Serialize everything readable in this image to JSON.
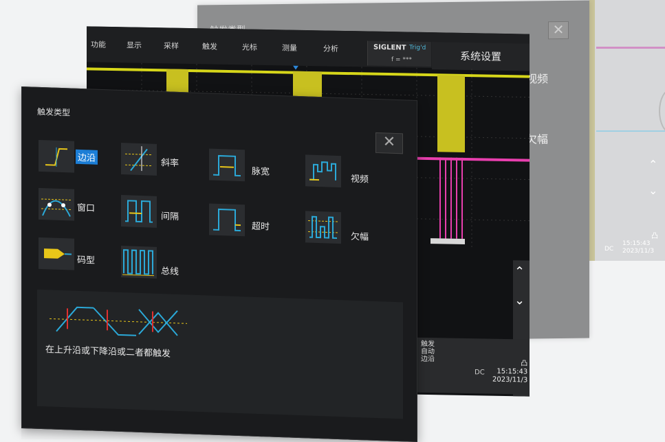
{
  "back_panel": {
    "title": "触发类型",
    "close": "✕",
    "video_label": "视频",
    "runt_label": "欠幅",
    "channel": "凸",
    "dc": "DC",
    "time": "15:15:43",
    "date": "2023/11/3",
    "up_arrow": "⌃",
    "down_arrow": "⌄"
  },
  "mid_panel": {
    "menu": [
      "功能",
      "显示",
      "采样",
      "触发",
      "光标",
      "测量",
      "分析"
    ],
    "brand": "SIGLENT",
    "brand_sub": "Trig'd",
    "brand_line2": "f = ***",
    "system_button": "系统设置",
    "status_lines": [
      "触发",
      "自动",
      "边沿"
    ],
    "dc": "DC",
    "time": "15:15:43",
    "date": "2023/11/3",
    "channel": "凸",
    "up_arrow": "⌃",
    "down_arrow": "⌄"
  },
  "dialog": {
    "title": "触发类型",
    "close": "✕",
    "types": [
      {
        "name": "edge",
        "label": "边沿",
        "selected": true
      },
      {
        "name": "slope",
        "label": "斜率"
      },
      {
        "name": "pulse",
        "label": "脉宽"
      },
      {
        "name": "video",
        "label": "视频"
      },
      {
        "name": "window",
        "label": "窗口"
      },
      {
        "name": "interval",
        "label": "间隔"
      },
      {
        "name": "timeout",
        "label": "超时"
      },
      {
        "name": "runt",
        "label": "欠幅"
      },
      {
        "name": "pattern",
        "label": "码型"
      },
      {
        "name": "bus",
        "label": "总线"
      }
    ],
    "description": "在上升沿或下降沿或二者都触发"
  },
  "colors": {
    "ch1": "#d6d61a",
    "ch2": "#e83fae",
    "ch3": "#2ba9d8",
    "accent": "#1c7ed6"
  }
}
